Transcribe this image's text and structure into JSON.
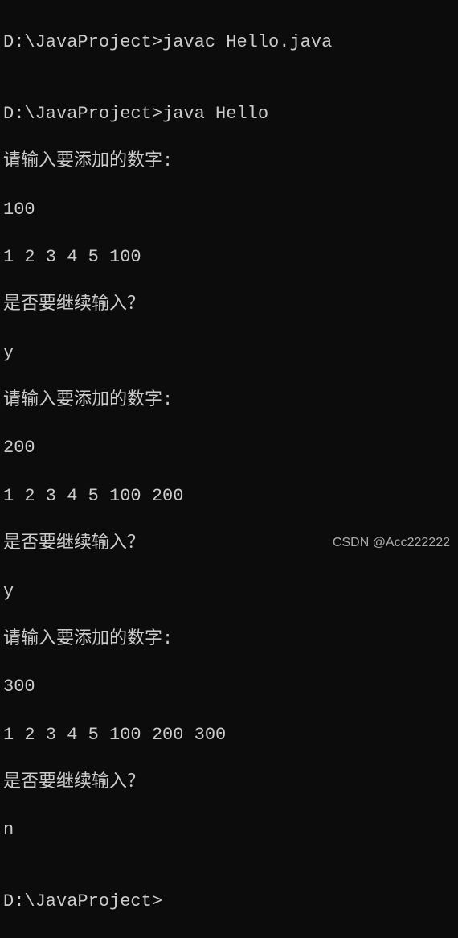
{
  "terminal": {
    "lines": [
      "D:\\JavaProject>javac Hello.java",
      "",
      "D:\\JavaProject>java Hello",
      "请输入要添加的数字:",
      "100",
      "1 2 3 4 5 100",
      "是否要继续输入？",
      "y",
      "请输入要添加的数字:",
      "200",
      "1 2 3 4 5 100 200",
      "是否要继续输入？",
      "y",
      "请输入要添加的数字:",
      "300",
      "1 2 3 4 5 100 200 300",
      "是否要继续输入？",
      "n",
      "",
      "D:\\JavaProject>"
    ]
  },
  "watermark": "CSDN @Acc222222"
}
